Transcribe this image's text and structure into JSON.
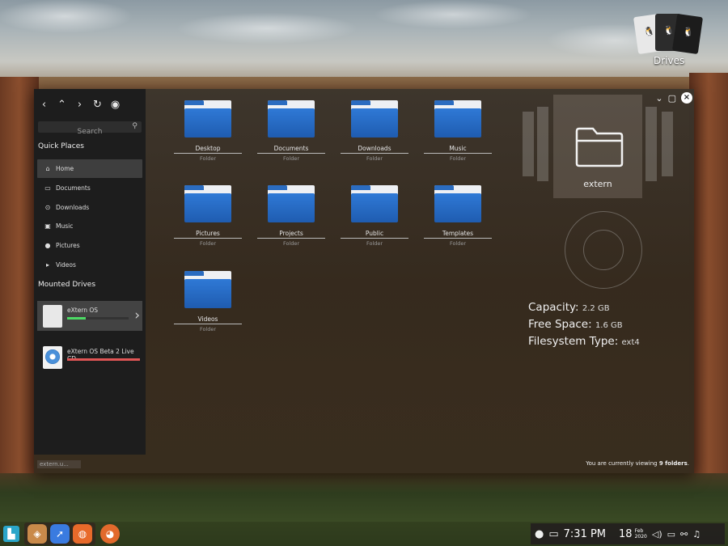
{
  "desktop": {
    "drives_label": "Drives"
  },
  "window": {
    "nav": {
      "back_icon": "chevron-left-icon",
      "up_icon": "chevron-up-icon",
      "forward_icon": "chevron-right-icon",
      "refresh_icon": "refresh-icon",
      "view_icon": "eye-icon"
    },
    "search": {
      "placeholder": "Search"
    },
    "sidebar": {
      "quick_places_title": "Quick Places",
      "places": [
        {
          "label": "Home",
          "icon": "home-icon"
        },
        {
          "label": "Documents",
          "icon": "folder-icon"
        },
        {
          "label": "Downloads",
          "icon": "download-icon"
        },
        {
          "label": "Music",
          "icon": "music-icon"
        },
        {
          "label": "Pictures",
          "icon": "picture-icon"
        },
        {
          "label": "Videos",
          "icon": "video-icon"
        }
      ],
      "mounted_title": "Mounted Drives",
      "drives": [
        {
          "name": "eXtern OS",
          "usage_fraction": 0.3,
          "bar_color": "#4cd964"
        },
        {
          "name": "eXtern OS Beta 2 Live CD",
          "usage_fraction": 1.0,
          "bar_color": "#e05555"
        }
      ],
      "path_label": "extern.u..."
    },
    "folders": [
      {
        "name": "Desktop",
        "type": "Folder"
      },
      {
        "name": "Documents",
        "type": "Folder"
      },
      {
        "name": "Downloads",
        "type": "Folder"
      },
      {
        "name": "Music",
        "type": "Folder"
      },
      {
        "name": "Pictures",
        "type": "Folder"
      },
      {
        "name": "Projects",
        "type": "Folder"
      },
      {
        "name": "Public",
        "type": "Folder"
      },
      {
        "name": "Templates",
        "type": "Folder"
      },
      {
        "name": "Videos",
        "type": "Folder"
      }
    ],
    "preview": {
      "label": "extern",
      "capacity_label": "Capacity:",
      "capacity_value": "2.2 GB",
      "free_label": "Free Space:",
      "free_value": "1.6 GB",
      "fs_label": "Filesystem Type:",
      "fs_value": "ext4"
    },
    "status": {
      "prefix": "You are currently viewing ",
      "count": "9 folders",
      "suffix": "."
    }
  },
  "taskbar": {
    "time": "7:31 PM",
    "day": "18",
    "month": "Feb",
    "year": "2020"
  }
}
